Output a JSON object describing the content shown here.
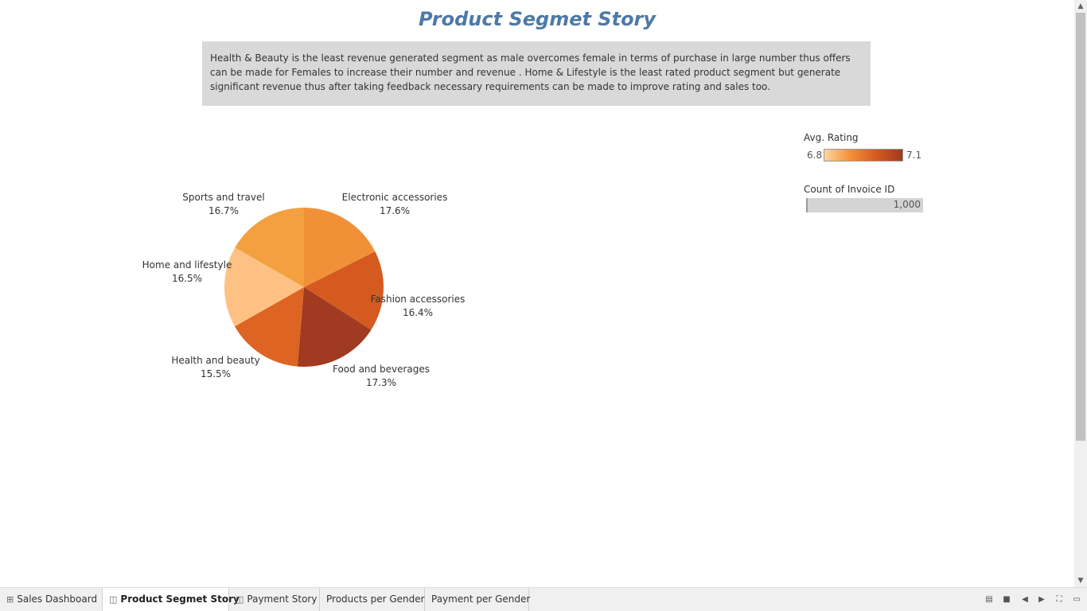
{
  "page": {
    "title": "Product Segmet Story",
    "description": "Health & Beauty is the least revenue generated segment as male overcomes female in terms of purchase in large number thus offers can be made for Females to increase their number and revenue . Home & Lifestyle is the least rated product segment but generate significant revenue thus after taking feedback necessary requirements can be made to improve rating and sales too."
  },
  "chart_data": {
    "type": "pie",
    "title": "",
    "slices": [
      {
        "label": "Electronic accessories",
        "value": 17.6,
        "display": "17.6%",
        "color": "#f29038"
      },
      {
        "label": "Fashion accessories",
        "value": 16.4,
        "display": "16.4%",
        "color": "#d45a20"
      },
      {
        "label": "Food and beverages",
        "value": 17.3,
        "display": "17.3%",
        "color": "#a03a20"
      },
      {
        "label": "Health and beauty",
        "value": 15.5,
        "display": "15.5%",
        "color": "#de6424"
      },
      {
        "label": "Home and lifestyle",
        "value": 16.5,
        "display": "16.5%",
        "color": "#fdc283"
      },
      {
        "label": "Sports and travel",
        "value": 16.7,
        "display": "16.7%",
        "color": "#f4a040"
      }
    ],
    "color_encoding": "Avg. Rating",
    "size_encoding": "Count of Invoice ID"
  },
  "legend": {
    "rating_title": "Avg. Rating",
    "rating_min": "6.8",
    "rating_max": "7.1",
    "rating_gradient": [
      "#fdd49e",
      "#f29038",
      "#d45a20",
      "#a03a20"
    ],
    "count_title": "Count of Invoice ID",
    "count_value": "1,000"
  },
  "tabs": [
    {
      "label": "Sales Dashboard",
      "icon": "grid-icon",
      "glyph": "⊞",
      "active": false
    },
    {
      "label": "Product Segmet Story",
      "icon": "story-icon",
      "glyph": "📖",
      "active": true
    },
    {
      "label": "Payment Story",
      "icon": "story-icon",
      "glyph": "📖",
      "active": false
    },
    {
      "label": "Products per Gender",
      "icon": "",
      "glyph": "",
      "active": false
    },
    {
      "label": "Payment per Gender",
      "icon": "",
      "glyph": "",
      "active": false
    }
  ],
  "controls": [
    {
      "name": "film-strip-icon",
      "glyph": "▤"
    },
    {
      "name": "single-sheet-icon",
      "glyph": "■"
    },
    {
      "name": "previous-sheet-icon",
      "glyph": "◀"
    },
    {
      "name": "next-sheet-icon",
      "glyph": "▶"
    },
    {
      "name": "fullscreen-icon",
      "glyph": "⛶"
    },
    {
      "name": "presentation-mode-icon",
      "glyph": "▭"
    }
  ]
}
